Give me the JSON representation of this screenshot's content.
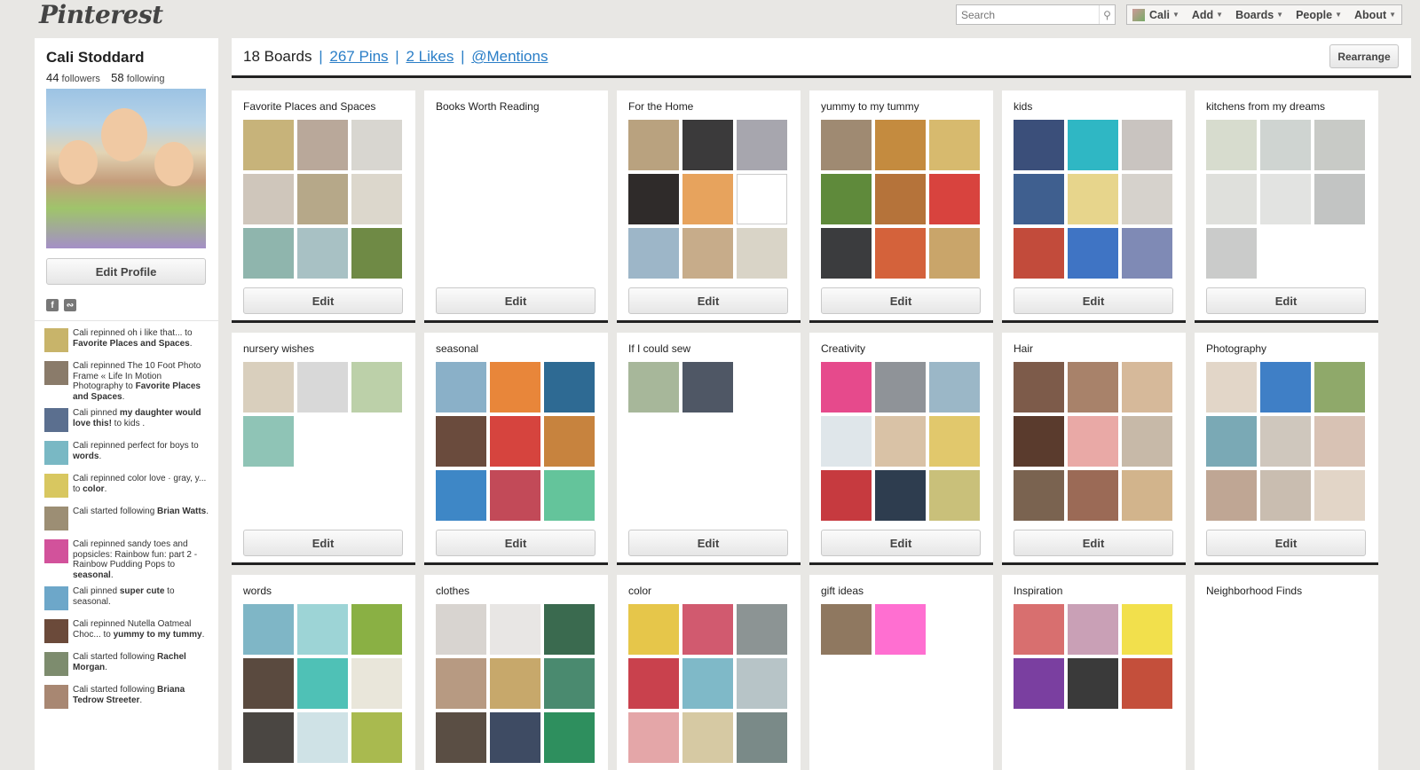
{
  "topbar": {
    "logo": "Pinterest",
    "search_placeholder": "Search",
    "nav": [
      {
        "label": "Cali",
        "key": "user"
      },
      {
        "label": "Add",
        "key": "add"
      },
      {
        "label": "Boards",
        "key": "boards"
      },
      {
        "label": "People",
        "key": "people"
      },
      {
        "label": "About",
        "key": "about"
      }
    ]
  },
  "profile": {
    "name": "Cali Stoddard",
    "followers_count": "44",
    "followers_label": "followers",
    "following_count": "58",
    "following_label": "following",
    "edit_label": "Edit Profile"
  },
  "activity": [
    {
      "pre": "Cali repinned oh i like that... to ",
      "bold": "Favorite Places and Spaces",
      "post": ".",
      "color": "#c8b46a"
    },
    {
      "pre": "Cali repinned The 10 Foot Photo Frame « Life In Motion Photography to ",
      "bold": "Favorite Places and Spaces",
      "post": ".",
      "color": "#8a7b6a"
    },
    {
      "pre": "Cali pinned ",
      "bold": "my daughter would love this!",
      "post": " to kids .",
      "color": "#5b6f8f"
    },
    {
      "pre": "Cali repinned perfect for boys to ",
      "bold": "words",
      "post": ".",
      "color": "#79b8c4"
    },
    {
      "pre": "Cali repinned color love · gray, y... to ",
      "bold": "color",
      "post": ".",
      "color": "#d8c760"
    },
    {
      "pre": "Cali started following ",
      "bold": "Brian Watts",
      "post": ".",
      "color": "#9c8e74"
    },
    {
      "pre": "Cali repinned sandy toes and popsicles: Rainbow fun: part 2 - Rainbow Pudding Pops to ",
      "bold": "seasonal",
      "post": ".",
      "color": "#d2529b"
    },
    {
      "pre": "Cali pinned ",
      "bold": "super cute",
      "post": " to seasonal.",
      "color": "#6da7c9"
    },
    {
      "pre": "Cali repinned Nutella Oatmeal Choc... to ",
      "bold": "yummy to my tummy",
      "post": ".",
      "color": "#6b4a3a"
    },
    {
      "pre": "Cali started following ",
      "bold": "Rachel Morgan",
      "post": ".",
      "color": "#7d8c6e"
    },
    {
      "pre": "Cali started following ",
      "bold": "Briana Tedrow Streeter",
      "post": ".",
      "color": "#a88772"
    }
  ],
  "header": {
    "boards": "18 Boards",
    "pins": "267 Pins",
    "likes": "2 Likes",
    "mentions": "@Mentions",
    "sep": "|",
    "rearrange": "Rearrange"
  },
  "edit_label": "Edit",
  "boards": [
    {
      "title": "Favorite Places and Spaces",
      "colors": [
        "#c7b37a",
        "#b9a89a",
        "#d8d6d0",
        "#cfc6bb",
        "#b6a889",
        "#dcd7cc",
        "#8fb5ad",
        "#a8c1c4",
        "#6f8a45"
      ],
      "edit": true
    },
    {
      "title": "Books Worth Reading",
      "colors": [],
      "edit": true
    },
    {
      "title": "For the Home",
      "colors": [
        "#b9a27f",
        "#3b3a3b",
        "#a7a6ae",
        "#2f2b2a",
        "#e7a35d",
        "#ffffff",
        "#9db6c8",
        "#c7ac8a",
        "#d9d4c7"
      ],
      "edit": true
    },
    {
      "title": "yummy to my tummy",
      "colors": [
        "#9f8a72",
        "#c48b3f",
        "#d7ba6e",
        "#5f8a3b",
        "#b5733a",
        "#d8433e",
        "#3b3c3e",
        "#d4623b",
        "#c9a56a"
      ],
      "edit": true
    },
    {
      "title": "kids",
      "colors": [
        "#3b4f7a",
        "#2fb7c4",
        "#c9c4c0",
        "#3f5f8f",
        "#e7d58c",
        "#d6d2cc",
        "#c24b3b",
        "#3f74c4",
        "#7f8ab5"
      ],
      "edit": true
    },
    {
      "title": "kitchens from my dreams",
      "colors": [
        "#d7dcce",
        "#cfd4d1",
        "#c8cac6",
        "#dfe0dc",
        "#e2e3e1",
        "#c2c4c3",
        "#cacbca"
      ],
      "edit": true
    },
    {
      "title": "nursery wishes",
      "colors": [
        "#d9cfbd",
        "#d8d8d8",
        "#bcd0a9",
        "#8fc4b6"
      ],
      "edit": true
    },
    {
      "title": "seasonal",
      "colors": [
        "#8ab0c8",
        "#e8863a",
        "#2e6a93",
        "#6a4b3d",
        "#d6443e",
        "#c7833e",
        "#3e87c6",
        "#c24a58",
        "#64c49b"
      ],
      "edit": true
    },
    {
      "title": "If I could sew",
      "colors": [
        "#a7b79a",
        "#4f5765"
      ],
      "edit": true
    },
    {
      "title": "Creativity",
      "colors": [
        "#e64a8c",
        "#8f9398",
        "#9bb7c7",
        "#dfe6ea",
        "#d9c2a6",
        "#e1c86c",
        "#c63a3f",
        "#2e3d4f",
        "#c9c07a"
      ],
      "edit": true
    },
    {
      "title": "Hair",
      "colors": [
        "#7d5b4a",
        "#a8826a",
        "#d6b99a",
        "#5a3b2d",
        "#e9a9a6",
        "#c7b9a8",
        "#7a6350",
        "#9b6a56",
        "#d2b48c"
      ],
      "edit": true
    },
    {
      "title": "Photography",
      "colors": [
        "#e2d6c8",
        "#3f7fc6",
        "#8fa96a",
        "#7aa9b5",
        "#cfc7bd",
        "#d8c2b4",
        "#bfa694",
        "#c9bdb0",
        "#e2d5c7"
      ],
      "edit": true
    },
    {
      "title": "words",
      "colors": [
        "#7fb6c6",
        "#9dd4d6",
        "#8ab044",
        "#5a4a3f",
        "#4fc1b6",
        "#e9e6da",
        "#4a4642",
        "#cfe2e6",
        "#a9ba4f"
      ],
      "edit": false
    },
    {
      "title": "clothes",
      "colors": [
        "#d8d4d0",
        "#e8e6e4",
        "#3a6a4f",
        "#b79a82",
        "#c7a86b",
        "#4a8a6f",
        "#5a4e44",
        "#3e4b63",
        "#2e8f5e"
      ],
      "edit": false
    },
    {
      "title": "color",
      "colors": [
        "#e6c64a",
        "#d15a6f",
        "#8c9494",
        "#c9414d",
        "#7fb9c8",
        "#b7c4c7",
        "#e4a6a8",
        "#d6c9a3",
        "#7a8a88"
      ],
      "edit": false
    },
    {
      "title": "gift ideas",
      "colors": [
        "#8f7860",
        "#ff6fd1"
      ],
      "edit": false
    },
    {
      "title": "Inspiration",
      "colors": [
        "#d86f6f",
        "#c9a0b6",
        "#f2e04c",
        "#7a3fa0",
        "#3a3a3a",
        "#c44f3b"
      ],
      "edit": false
    },
    {
      "title": "Neighborhood Finds",
      "colors": [],
      "edit": false
    }
  ]
}
